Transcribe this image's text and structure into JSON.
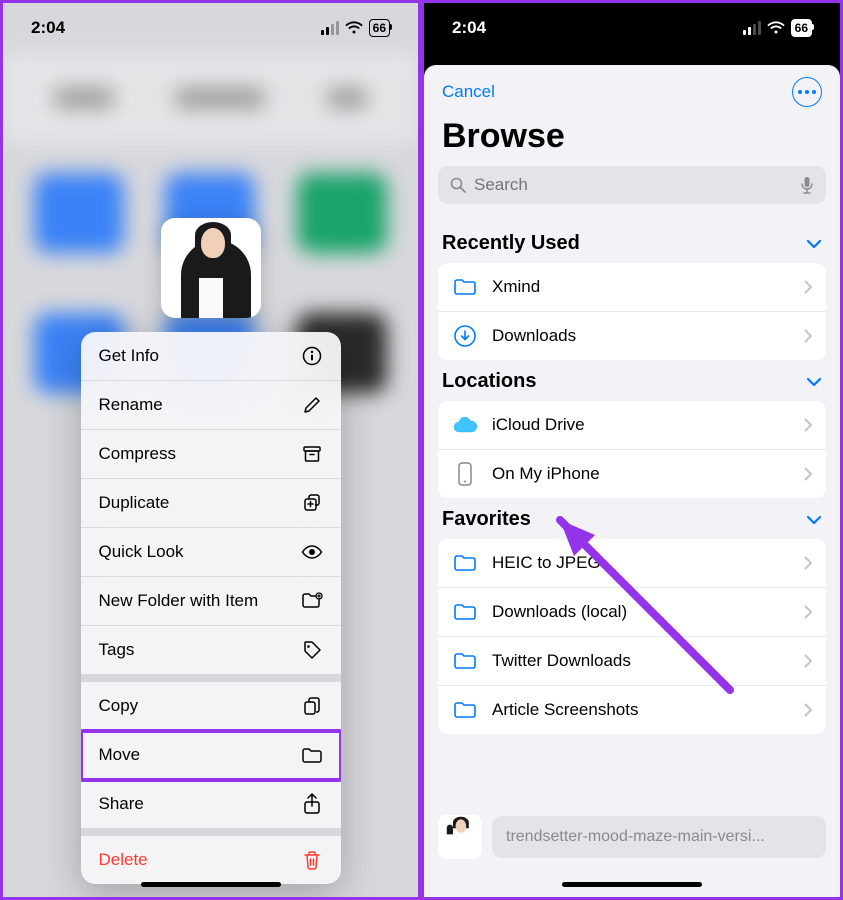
{
  "status": {
    "time": "2:04",
    "battery": "66"
  },
  "left": {
    "menu_groups": [
      [
        {
          "label": "Get Info",
          "icon": "info"
        },
        {
          "label": "Rename",
          "icon": "pencil"
        },
        {
          "label": "Compress",
          "icon": "archive"
        },
        {
          "label": "Duplicate",
          "icon": "duplicate"
        },
        {
          "label": "Quick Look",
          "icon": "eye"
        },
        {
          "label": "New Folder with Item",
          "icon": "folder-new"
        },
        {
          "label": "Tags",
          "icon": "tag"
        }
      ],
      [
        {
          "label": "Copy",
          "icon": "copy"
        },
        {
          "label": "Move",
          "icon": "folder",
          "highlight": true
        },
        {
          "label": "Share",
          "icon": "share"
        }
      ],
      [
        {
          "label": "Delete",
          "icon": "trash",
          "destructive": true
        }
      ]
    ]
  },
  "right": {
    "cancel": "Cancel",
    "title": "Browse",
    "search_placeholder": "Search",
    "sections": [
      {
        "header": "Recently Used",
        "rows": [
          {
            "label": "Xmind",
            "icon": "folder"
          },
          {
            "label": "Downloads",
            "icon": "download-circle"
          }
        ]
      },
      {
        "header": "Locations",
        "rows": [
          {
            "label": "iCloud Drive",
            "icon": "icloud"
          },
          {
            "label": "On My iPhone",
            "icon": "iphone"
          }
        ]
      },
      {
        "header": "Favorites",
        "rows": [
          {
            "label": "HEIC to JPEG",
            "icon": "folder"
          },
          {
            "label": "Downloads (local)",
            "icon": "folder"
          },
          {
            "label": "Twitter Downloads",
            "icon": "folder"
          },
          {
            "label": "Article Screenshots",
            "icon": "folder"
          }
        ]
      }
    ],
    "moving_file": "trendsetter-mood-maze-main-versi..."
  }
}
